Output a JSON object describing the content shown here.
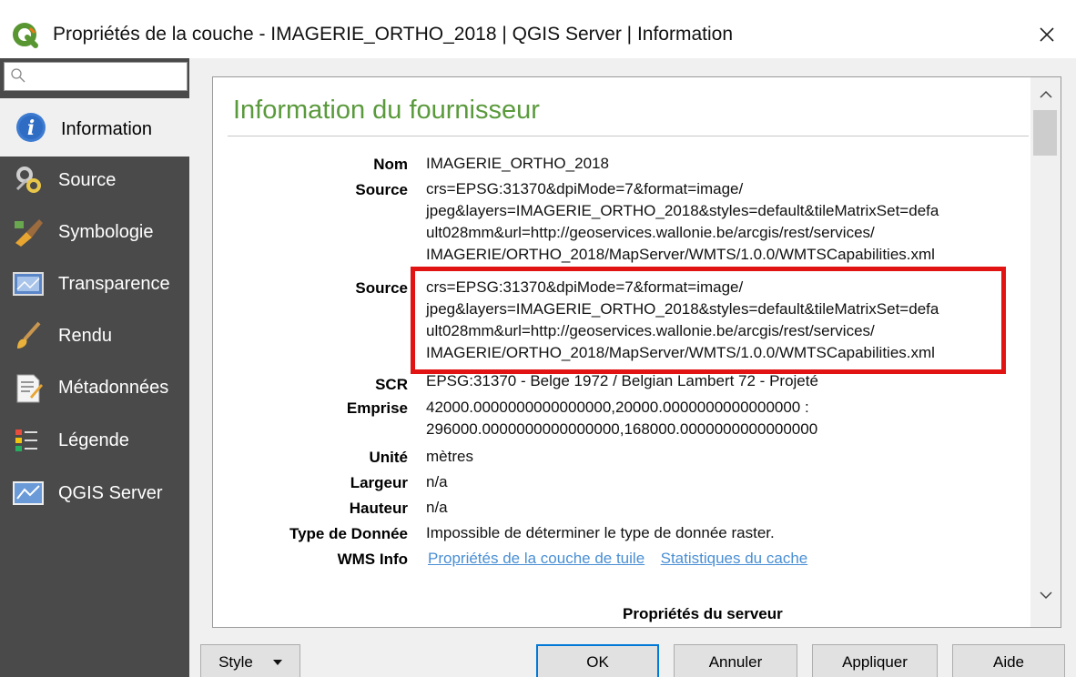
{
  "window": {
    "title": "Propriétés de la couche - IMAGERIE_ORTHO_2018 | QGIS Server | Information"
  },
  "icons": {
    "app": "qgis-logo-icon",
    "close": "close-icon",
    "search": "search-icon"
  },
  "sidebar": {
    "search_placeholder": "",
    "items": [
      {
        "label": "Information",
        "icon": "info-icon",
        "active": true
      },
      {
        "label": "Source",
        "icon": "source-icon",
        "active": false
      },
      {
        "label": "Symbologie",
        "icon": "symbology-icon",
        "active": false
      },
      {
        "label": "Transparence",
        "icon": "transparency-icon",
        "active": false
      },
      {
        "label": "Rendu",
        "icon": "rendering-icon",
        "active": false
      },
      {
        "label": "Métadonnées",
        "icon": "metadata-icon",
        "active": false
      },
      {
        "label": "Légende",
        "icon": "legend-icon",
        "active": false
      },
      {
        "label": "QGIS Server",
        "icon": "qgis-server-icon",
        "active": false
      }
    ]
  },
  "panel": {
    "heading": "Information du fournisseur",
    "rows": {
      "nom": {
        "label": "Nom",
        "value": "IMAGERIE_ORTHO_2018"
      },
      "source1": {
        "label": "Source",
        "lines": [
          "crs=EPSG:31370&dpiMode=7&format=image/",
          "jpeg&layers=IMAGERIE_ORTHO_2018&styles=default&tileMatrixSet=defa",
          "ult028mm&url=http://geoservices.wallonie.be/arcgis/rest/services/",
          "IMAGERIE/ORTHO_2018/MapServer/WMTS/1.0.0/WMTSCapabilities.xml"
        ]
      },
      "source2": {
        "label": "Source",
        "lines": [
          "crs=EPSG:31370&dpiMode=7&format=image/",
          "jpeg&layers=IMAGERIE_ORTHO_2018&styles=default&tileMatrixSet=defa",
          "ult028mm&url=http://geoservices.wallonie.be/arcgis/rest/services/",
          "IMAGERIE/ORTHO_2018/MapServer/WMTS/1.0.0/WMTSCapabilities.xml"
        ]
      },
      "scr": {
        "label": "SCR",
        "value": "EPSG:31370 - Belge 1972 / Belgian Lambert 72 - Projeté"
      },
      "emprise": {
        "label": "Emprise",
        "lines": [
          "42000.0000000000000000,20000.0000000000000000 :",
          "296000.0000000000000000,168000.0000000000000000"
        ]
      },
      "unite": {
        "label": "Unité",
        "value": "mètres"
      },
      "largeur": {
        "label": "Largeur",
        "value": "n/a"
      },
      "hauteur": {
        "label": "Hauteur",
        "value": "n/a"
      },
      "type": {
        "label": "Type de Donnée",
        "value": "Impossible de déterminer le type de donnée raster."
      },
      "wms": {
        "label": "WMS Info",
        "link1": "Propriétés de la couche de tuile",
        "link2": "Statistiques du cache"
      }
    },
    "section_title": "Propriétés du serveur"
  },
  "buttons": {
    "style": "Style",
    "ok": "OK",
    "cancel": "Annuler",
    "apply": "Appliquer",
    "help": "Aide"
  },
  "colors": {
    "sidebar_bg": "#4a4a4a",
    "heading_green": "#5a9a3c",
    "highlight_red": "#e21313",
    "link_blue": "#4a8fd4"
  }
}
